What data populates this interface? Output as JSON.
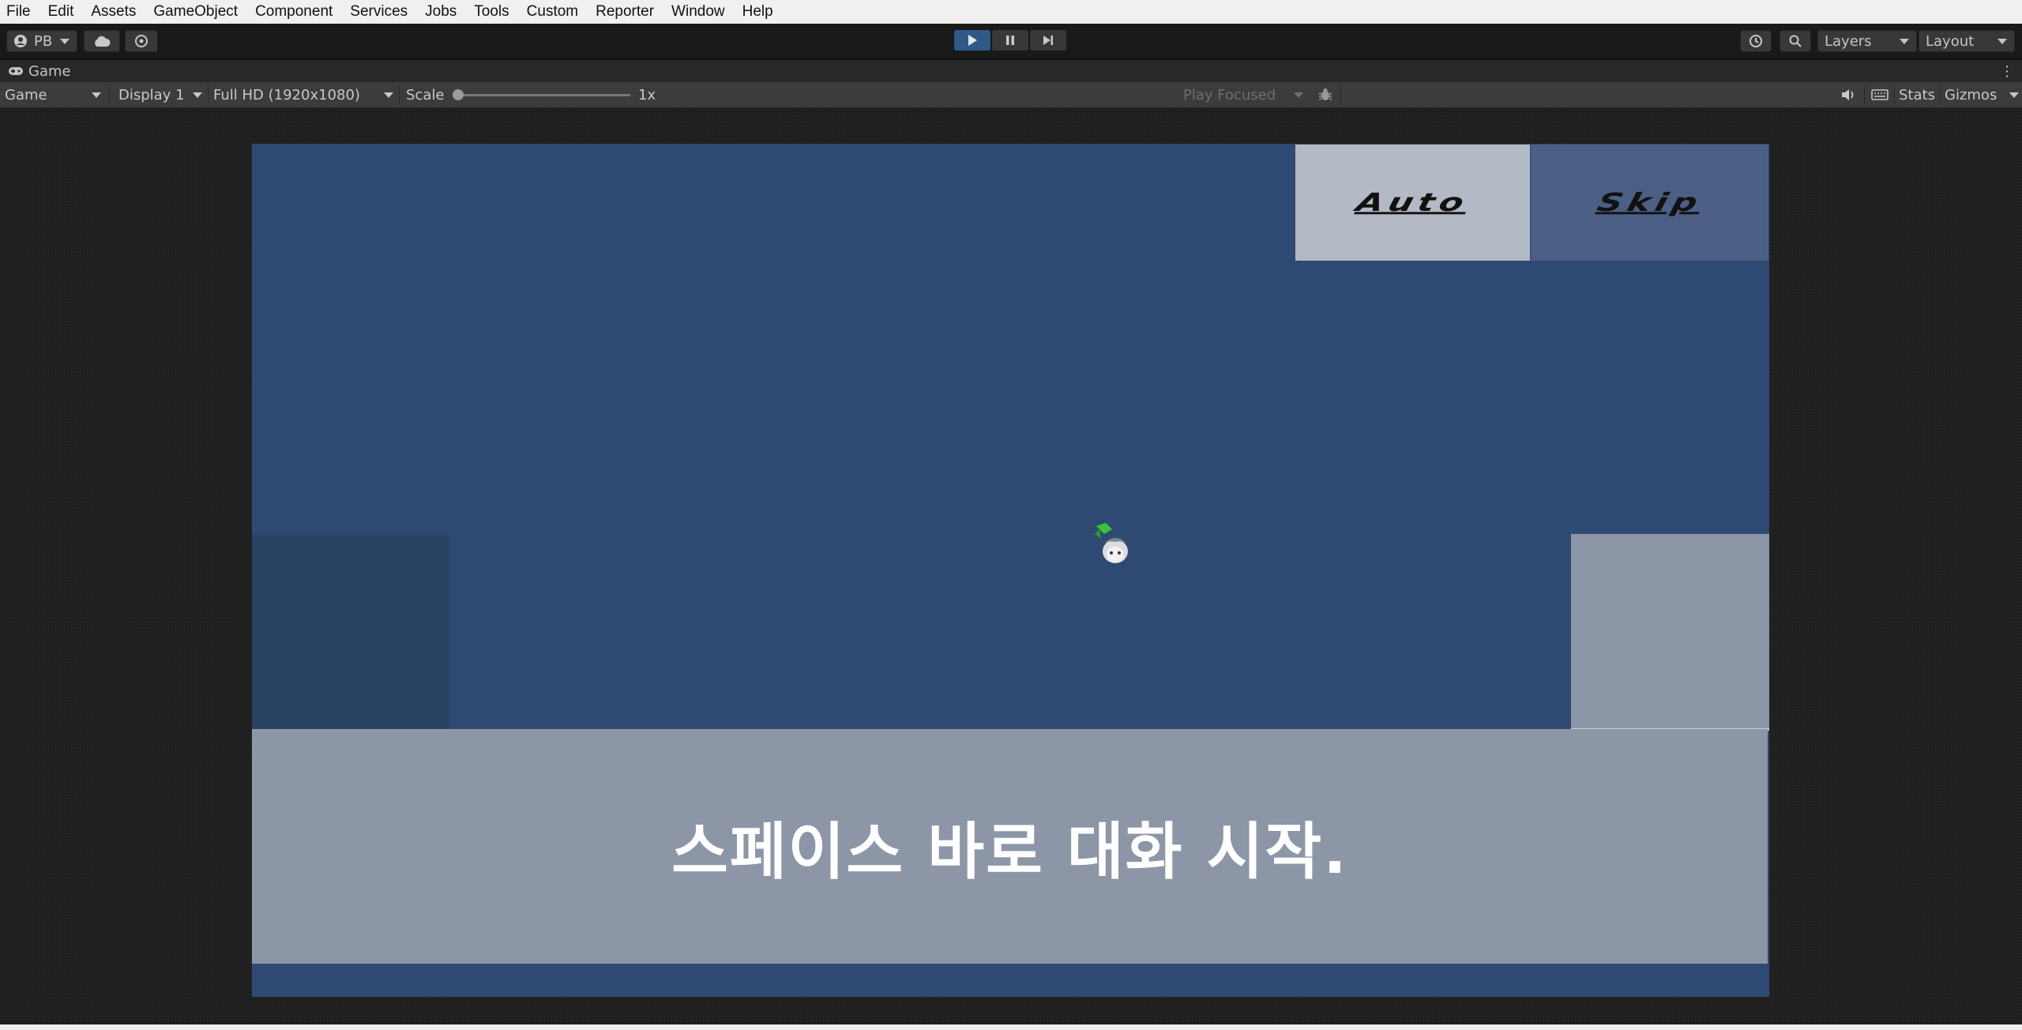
{
  "menu": [
    "File",
    "Edit",
    "Assets",
    "GameObject",
    "Component",
    "Services",
    "Jobs",
    "Tools",
    "Custom",
    "Reporter",
    "Window",
    "Help"
  ],
  "toolbar": {
    "account_label": "PB",
    "layers_label": "Layers",
    "layout_label": "Layout"
  },
  "game_window": {
    "tab_title": "Game",
    "view_select": "Game",
    "display_select": "Display 1",
    "resolution_select": "Full HD (1920x1080)",
    "scale_label": "Scale",
    "scale_value": "1x",
    "play_mode_select": "Play Focused",
    "stats_label": "Stats",
    "gizmos_label": "Gizmos"
  },
  "game": {
    "auto_button": "Auto",
    "skip_button": "Skip",
    "dialog_text": "스페이스 바로 대화 시작."
  },
  "colors": {
    "game_background": "#2f4a72",
    "dialog_panel": "#8d96a7",
    "auto_button_bg": "#b4b9c6",
    "skip_button_bg": "#4b5f84",
    "play_active": "#2f5a87"
  }
}
